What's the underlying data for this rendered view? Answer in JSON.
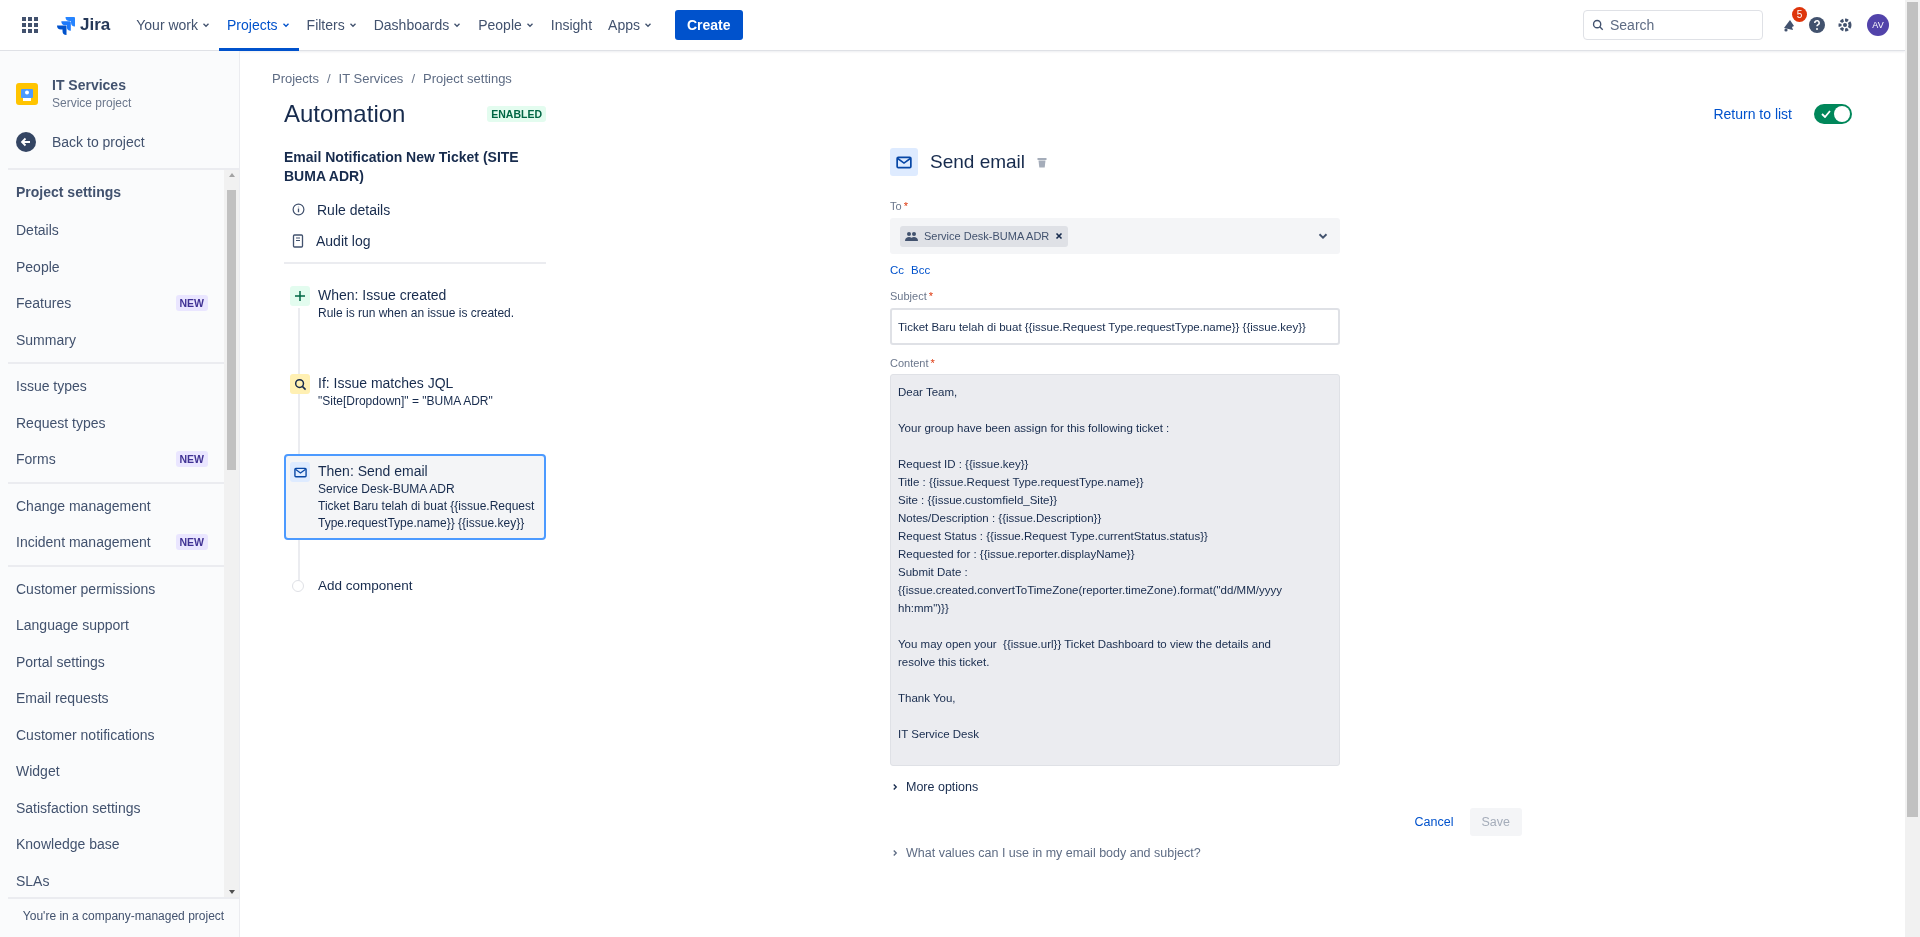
{
  "top_nav": {
    "logo": "Jira",
    "items": [
      {
        "label": "Your work",
        "dropdown": true,
        "selected": false
      },
      {
        "label": "Projects",
        "dropdown": true,
        "selected": true
      },
      {
        "label": "Filters",
        "dropdown": true,
        "selected": false
      },
      {
        "label": "Dashboards",
        "dropdown": true,
        "selected": false
      },
      {
        "label": "People",
        "dropdown": true,
        "selected": false
      },
      {
        "label": "Insight",
        "dropdown": false,
        "selected": false
      },
      {
        "label": "Apps",
        "dropdown": true,
        "selected": false
      }
    ],
    "create_button": "Create",
    "search": {
      "placeholder": "Search"
    },
    "notification_count": "5",
    "avatar": "AV"
  },
  "sidebar": {
    "project_name": "IT Services",
    "project_type": "Service project",
    "back_link": "Back to project",
    "heading": "Project settings",
    "groups": [
      [
        {
          "label": "Details"
        },
        {
          "label": "People"
        },
        {
          "label": "Features",
          "badge": "NEW"
        },
        {
          "label": "Summary"
        }
      ],
      [
        {
          "label": "Issue types"
        },
        {
          "label": "Request types"
        },
        {
          "label": "Forms",
          "badge": "NEW"
        }
      ],
      [
        {
          "label": "Change management"
        },
        {
          "label": "Incident management",
          "badge": "NEW"
        }
      ],
      [
        {
          "label": "Customer permissions"
        },
        {
          "label": "Language support"
        },
        {
          "label": "Portal settings"
        },
        {
          "label": "Email requests"
        },
        {
          "label": "Customer notifications"
        },
        {
          "label": "Widget"
        },
        {
          "label": "Satisfaction settings"
        },
        {
          "label": "Knowledge base"
        },
        {
          "label": "SLAs"
        }
      ]
    ],
    "footer": "You're in a company-managed project"
  },
  "breadcrumbs": {
    "separator": "/",
    "items": [
      "Projects",
      "IT Services",
      "Project settings"
    ]
  },
  "page_title": "Automation",
  "status_badge": "ENABLED",
  "return_link": "Return to list",
  "rule_toggle": {
    "on": true
  },
  "rule": {
    "name": "Email Notification New Ticket (SITE BUMA ADR)",
    "links": [
      {
        "kind": "info",
        "label": "Rule details"
      },
      {
        "kind": "log",
        "label": "Audit log"
      }
    ],
    "steps": [
      {
        "kind": "trigger",
        "title": "When: Issue created",
        "lines": [
          "Rule is run when an issue is created."
        ],
        "selected": false
      },
      {
        "kind": "condition",
        "title": "If: Issue matches JQL",
        "lines": [
          "\"Site[Dropdown]\" = \"BUMA ADR\""
        ],
        "selected": false
      },
      {
        "kind": "action",
        "title": "Then: Send email",
        "lines": [
          "Service Desk-BUMA ADR",
          "Ticket Baru telah di buat {{issue.Request Type.requestType.name}} {{issue.key}}"
        ],
        "selected": true
      }
    ],
    "add_component": "Add component"
  },
  "editor": {
    "title": "Send email",
    "to": {
      "label": "To",
      "required_mark": "*",
      "chips": [
        "Service Desk-BUMA ADR"
      ]
    },
    "cc_links": [
      "Cc",
      "Bcc"
    ],
    "subject": {
      "label": "Subject",
      "required_mark": "*",
      "value": "Ticket Baru telah di buat {{issue.Request Type.requestType.name}} {{issue.key}}"
    },
    "content": {
      "label": "Content",
      "required_mark": "*",
      "value": "Dear Team,\n\nYour group have been assign for this following ticket :\n\nRequest ID : {{issue.key}}\nTitle : {{issue.Request Type.requestType.name}}\nSite : {{issue.customfield_Site}}\nNotes/Description : {{issue.Description}}\nRequest Status : {{issue.Request Type.currentStatus.status}}\nRequested for : {{issue.reporter.displayName}}\nSubmit Date :\n{{issue.created.convertToTimeZone(reporter.timeZone).format(\"dd/MM/yyyy\nhh:mm\")}}\n\nYou may open your  {{issue.url}} Ticket Dashboard to view the details and\nresolve this ticket.\n\nThank You,\n\nIT Service Desk"
    },
    "more_options": "More options",
    "cancel": "Cancel",
    "save": {
      "label": "Save",
      "disabled": true
    },
    "help": "What values can I use in my email body and subject?"
  }
}
